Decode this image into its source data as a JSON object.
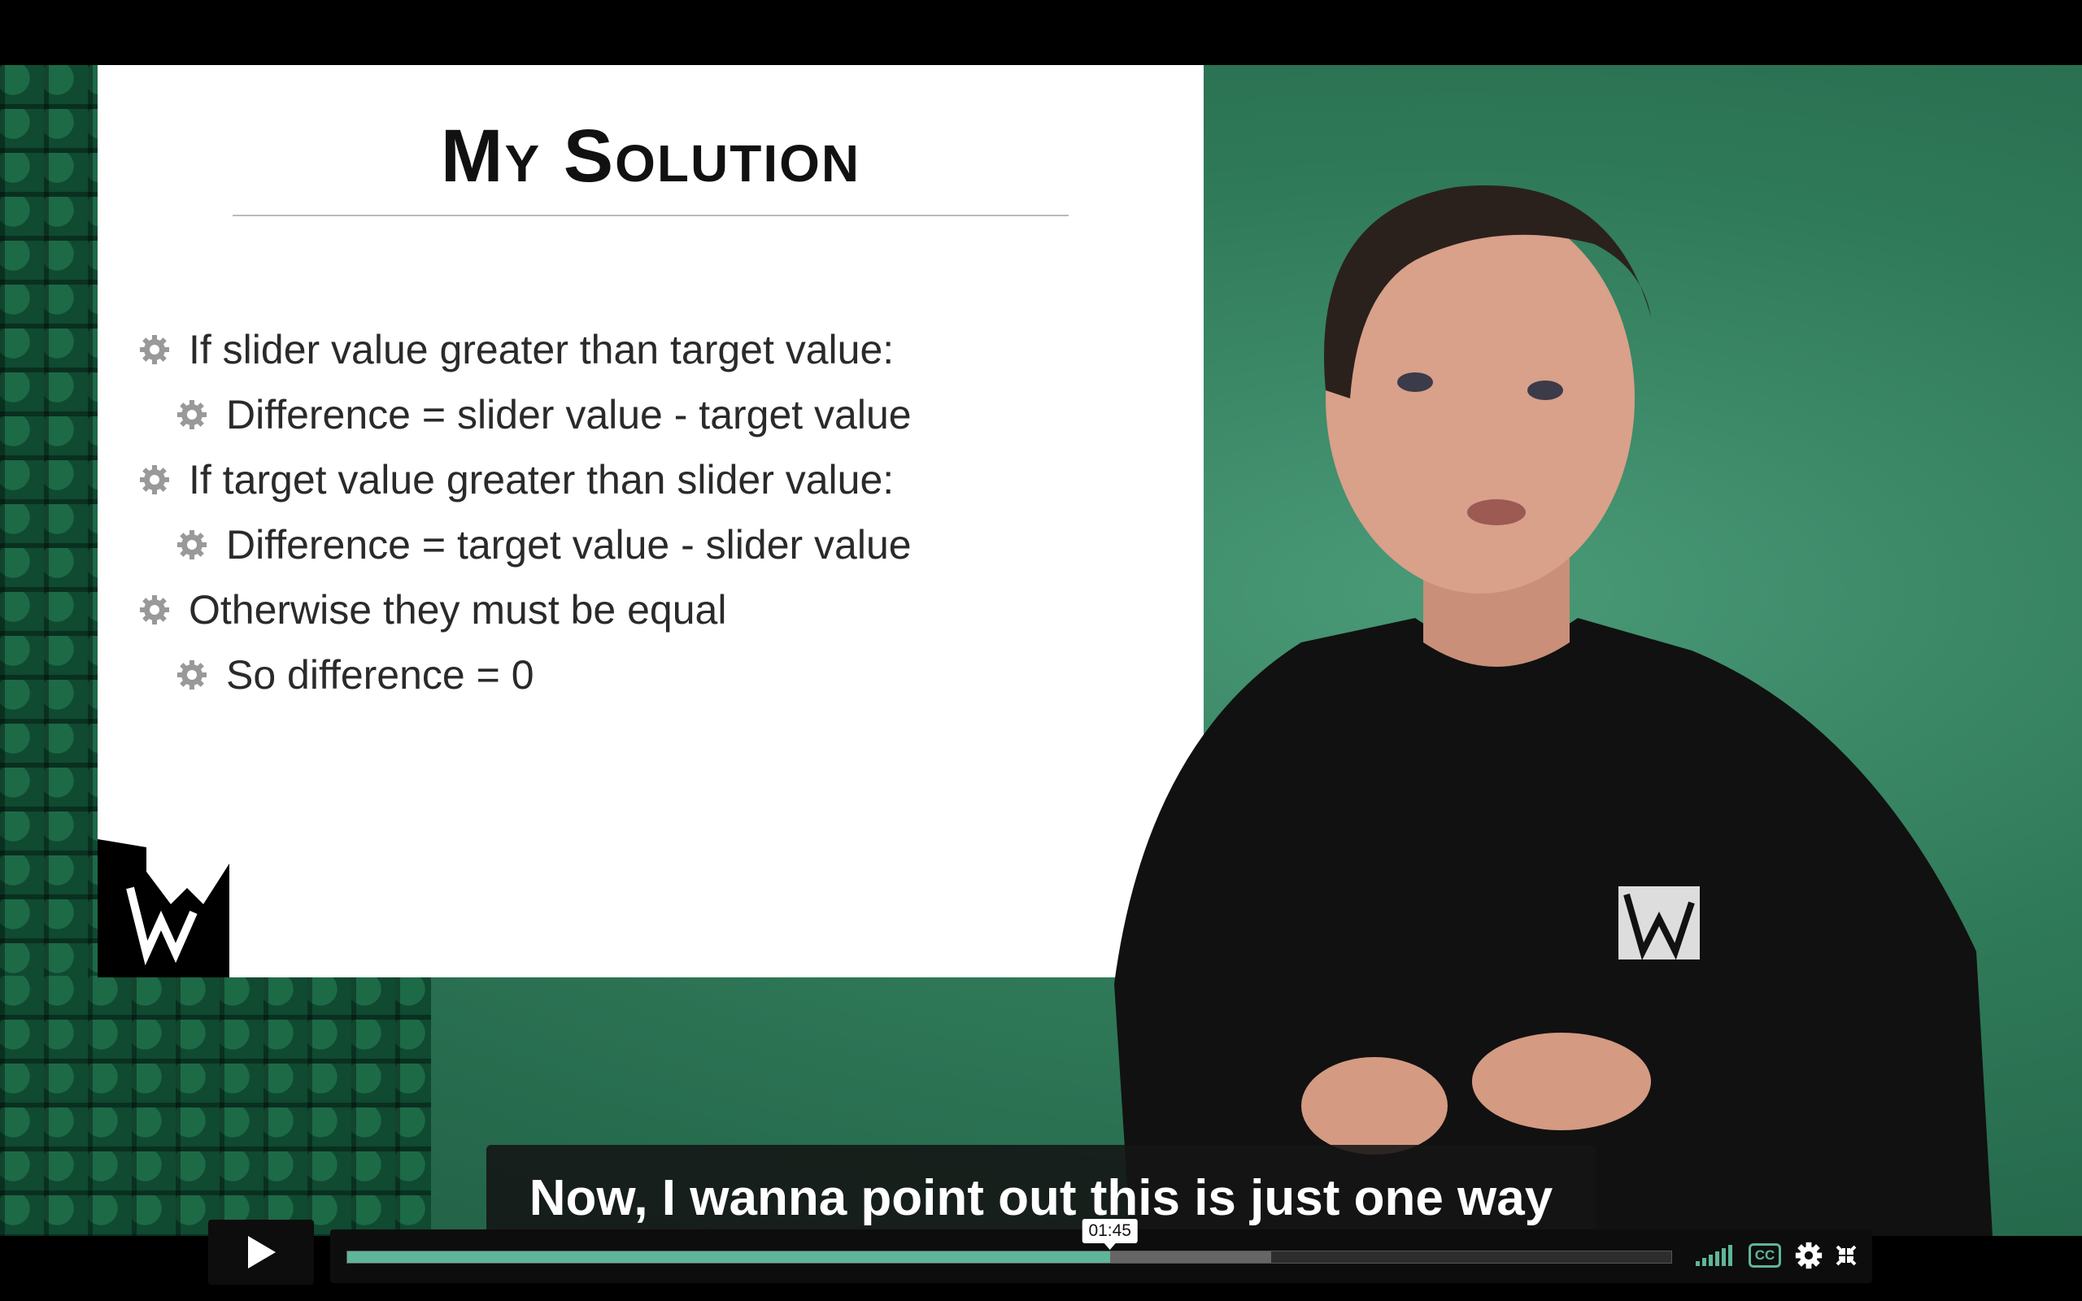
{
  "slide": {
    "title": "My Solution",
    "bullets": [
      {
        "level": 1,
        "text": "If slider value greater than target value:"
      },
      {
        "level": 2,
        "text": "Difference = slider value - target value"
      },
      {
        "level": 1,
        "text": "If target value greater than slider value:"
      },
      {
        "level": 2,
        "text": "Difference = target value - slider value"
      },
      {
        "level": 1,
        "text": "Otherwise they must be equal"
      },
      {
        "level": 2,
        "text": "So difference = 0"
      }
    ]
  },
  "caption": "Now, I wanna point out this is just one way",
  "player": {
    "time_tooltip": "01:45",
    "progress_fraction": 0.576,
    "buffered_fraction": 0.698,
    "accent_color": "#5fb59a",
    "cc_label": "CC",
    "icons": [
      "play-icon",
      "volume-icon",
      "cc-icon",
      "settings-icon",
      "fullscreen-exit-icon"
    ]
  }
}
